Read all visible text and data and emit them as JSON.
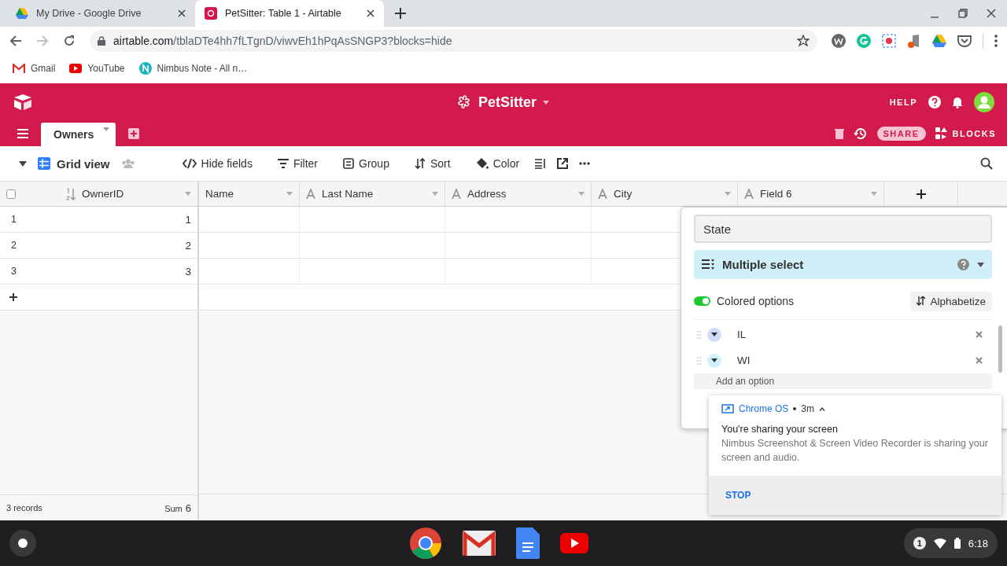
{
  "browser": {
    "tabs": [
      {
        "title": "My Drive - Google Drive",
        "selected": false
      },
      {
        "title": "PetSitter: Table 1 - Airtable",
        "selected": true
      }
    ],
    "url_host": "airtable.com",
    "url_path": "/tblaDTe4hh7fLTgnD/viwvEh1hPqAsSNGP3?blocks=hide",
    "bookmarks": [
      "Gmail",
      "YouTube",
      "Nimbus Note - All n…"
    ]
  },
  "app": {
    "base_name": "PetSitter",
    "help": "HELP",
    "tables": [
      {
        "label": "Owners",
        "selected": true
      }
    ],
    "share": "SHARE",
    "blocks": "BLOCKS"
  },
  "toolbar": {
    "view": "Grid view",
    "actions": [
      {
        "label": "Hide fields",
        "kind": "hide"
      },
      {
        "label": "Filter",
        "kind": "filter"
      },
      {
        "label": "Group",
        "kind": "group"
      },
      {
        "label": "Sort",
        "kind": "sort"
      },
      {
        "label": "Color",
        "kind": "color"
      }
    ]
  },
  "grid": {
    "select_all_checked": false,
    "columns": [
      {
        "label": "OwnerID",
        "kind": "number"
      },
      {
        "label": "Name",
        "kind": "cut"
      },
      {
        "label": "Last Name",
        "kind": "text"
      },
      {
        "label": "Address",
        "kind": "text"
      },
      {
        "label": "City",
        "kind": "text"
      },
      {
        "label": "Field 6",
        "kind": "text"
      }
    ],
    "rows": [
      {
        "number": "1",
        "owner_id": "1"
      },
      {
        "number": "2",
        "owner_id": "2"
      },
      {
        "number": "3",
        "owner_id": "3"
      }
    ],
    "footer": {
      "records": "3 records",
      "sum_label": "Sum",
      "sum_value": "6"
    }
  },
  "field_editor": {
    "name": "State",
    "type": "Multiple select",
    "colored_options": true,
    "colored_label": "Colored options",
    "alphabetize": "Alphabetize",
    "options": [
      {
        "label": "IL",
        "color": "#d0dcfa"
      },
      {
        "label": "WI",
        "color": "#d0f0fd"
      }
    ],
    "add_option": "Add an option"
  },
  "notification": {
    "source": "Chrome OS",
    "time": "3m",
    "title": "You're sharing your screen",
    "body": "Nimbus Screenshot & Screen Video Recorder is sharing your screen and audio.",
    "action": "STOP"
  },
  "shelf": {
    "badge": "1",
    "time": "6:18"
  }
}
